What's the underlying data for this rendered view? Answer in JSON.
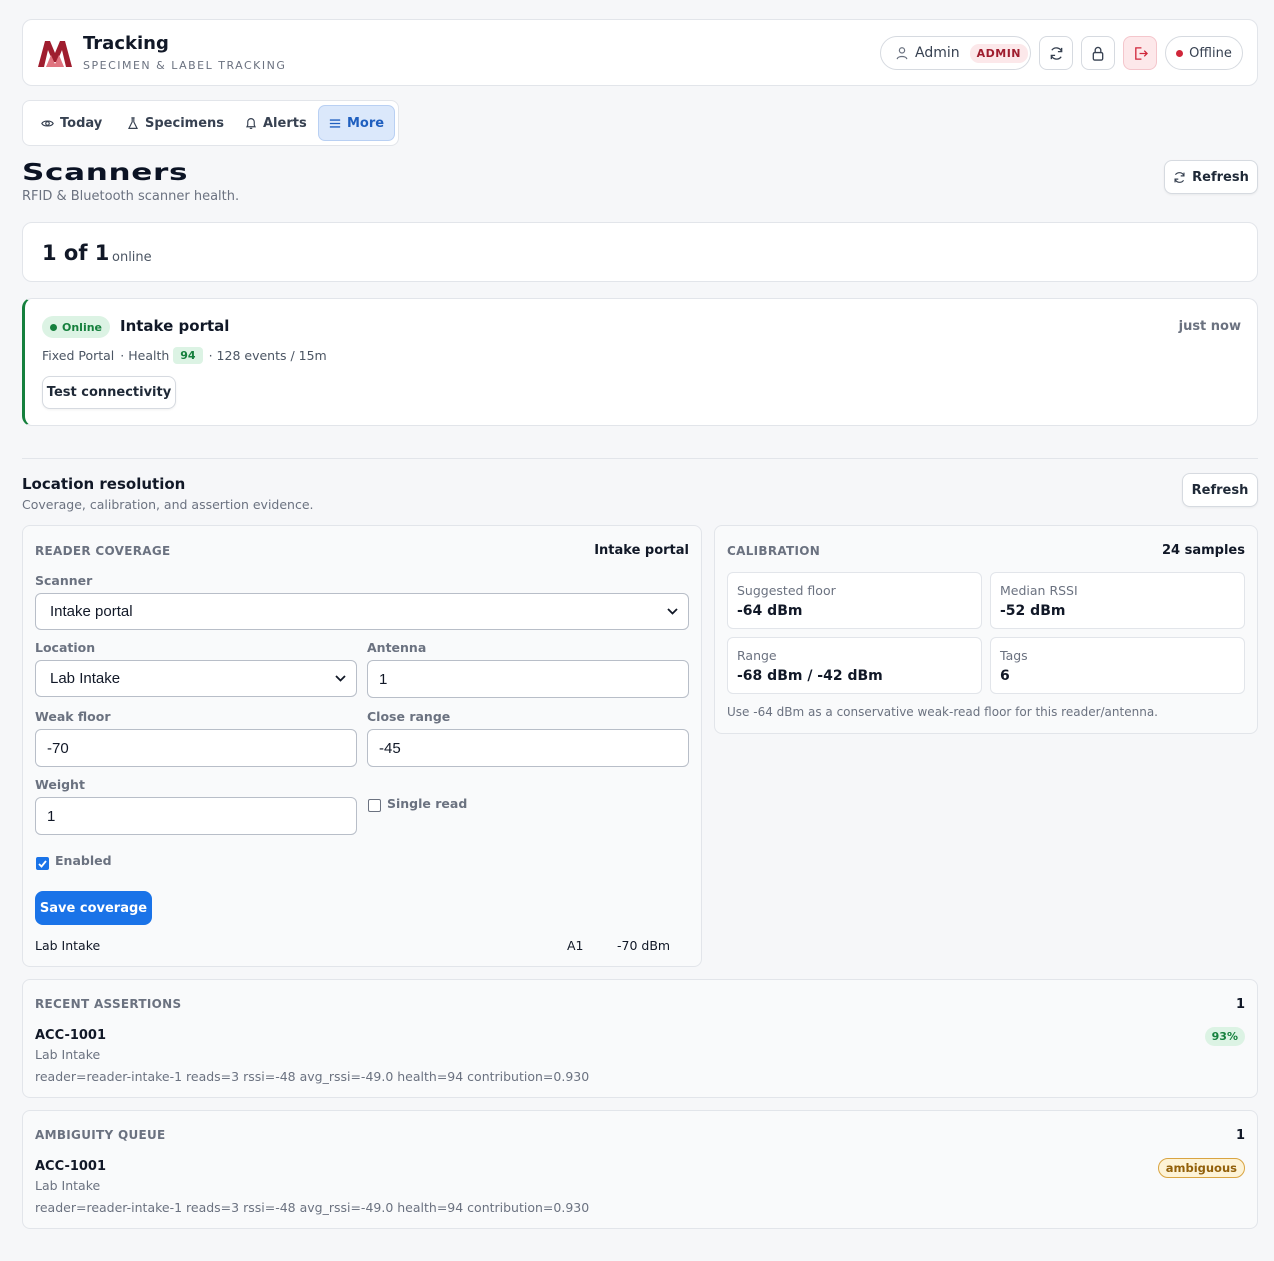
{
  "header": {
    "app_title": "Tracking",
    "app_subtitle": "SPECIMEN & LABEL TRACKING",
    "user_name": "Admin",
    "user_role": "ADMIN",
    "connection_status": "Offline",
    "connection_color": "#d0263a",
    "brand_color": "#9f1d2e",
    "icons": [
      "user-icon",
      "sync-icon",
      "lock-icon",
      "logout-icon"
    ]
  },
  "nav": {
    "tabs": [
      {
        "label": "Today",
        "icon": "eye-icon"
      },
      {
        "label": "Specimens",
        "icon": "flask-icon"
      },
      {
        "label": "Alerts",
        "icon": "bell-icon"
      },
      {
        "label": "More",
        "icon": "menu-icon",
        "active": true
      }
    ]
  },
  "page": {
    "title": "Scanners",
    "subtitle": "RFID & Bluetooth scanner health.",
    "refresh_label": "Refresh"
  },
  "summary": {
    "count": "1 of 1",
    "label": "online"
  },
  "scanner": {
    "status": "Online",
    "status_color": "#15803d",
    "name": "Intake portal",
    "last_seen": "just now",
    "type": "Fixed Portal",
    "health_label": "· Health",
    "health": "94",
    "events": "· 128 events / 15m",
    "test_label": "Test connectivity"
  },
  "location": {
    "title": "Location resolution",
    "subtitle": "Coverage, calibration, and assertion evidence.",
    "refresh_label": "Refresh"
  },
  "coverage": {
    "heading": "READER COVERAGE",
    "reader": "Intake portal",
    "scanner_label": "Scanner",
    "scanner_value": "Intake portal",
    "location_label": "Location",
    "location_value": "Lab Intake",
    "antenna_label": "Antenna",
    "antenna_value": "1",
    "weak_floor_label": "Weak floor",
    "weak_floor_value": "-70",
    "close_range_label": "Close range",
    "close_range_value": "-45",
    "weight_label": "Weight",
    "weight_value": "1",
    "single_read_label": "Single read",
    "single_read_checked": false,
    "enabled_label": "Enabled",
    "enabled_checked": true,
    "save_label": "Save coverage",
    "row": {
      "location": "Lab Intake",
      "antenna": "A1",
      "floor": "-70 dBm"
    }
  },
  "calibration": {
    "heading": "CALIBRATION",
    "samples": "24 samples",
    "stats": [
      {
        "key": "Suggested floor",
        "value": "-64 dBm"
      },
      {
        "key": "Median RSSI",
        "value": "-52 dBm"
      },
      {
        "key": "Range",
        "value": "-68 dBm / -42 dBm"
      },
      {
        "key": "Tags",
        "value": "6"
      }
    ],
    "note": "Use -64 dBm as a conservative weak-read floor for this reader/antenna."
  },
  "assertions": {
    "heading": "RECENT ASSERTIONS",
    "count": "1",
    "item": {
      "id": "ACC-1001",
      "location": "Lab Intake",
      "detail": "reader=reader-intake-1 reads=3 rssi=-48 avg_rssi=-49.0 health=94 contribution=0.930",
      "confidence": "93%"
    }
  },
  "ambiguity": {
    "heading": "AMBIGUITY QUEUE",
    "count": "1",
    "item": {
      "id": "ACC-1001",
      "location": "Lab Intake",
      "detail": "reader=reader-intake-1 reads=3 rssi=-48 avg_rssi=-49.0 health=94 contribution=0.930",
      "status": "ambiguous"
    }
  }
}
